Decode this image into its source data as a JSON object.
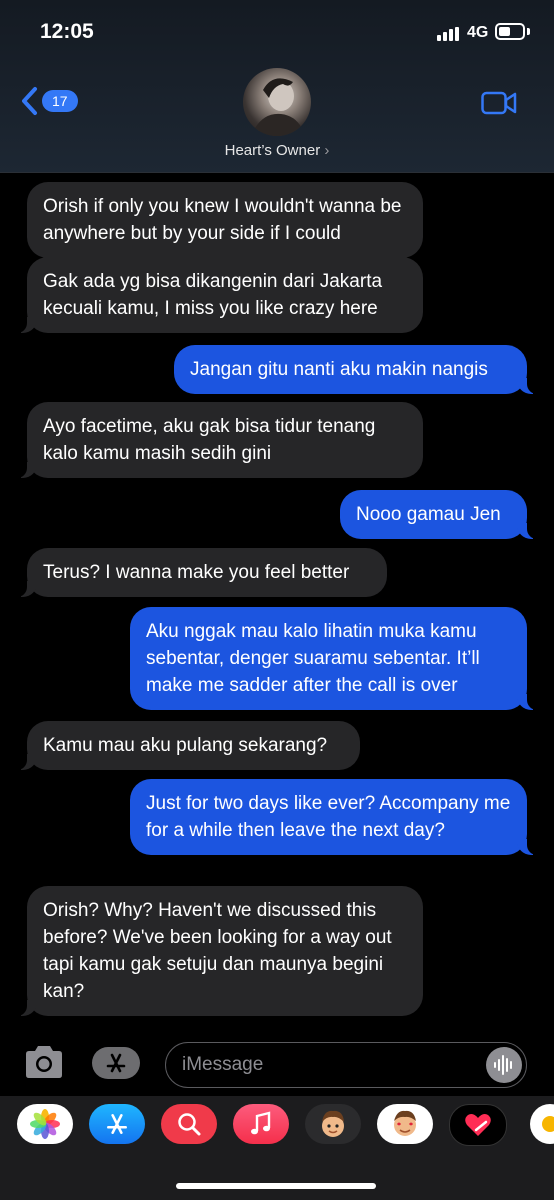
{
  "status": {
    "time": "12:05",
    "network": "4G"
  },
  "header": {
    "back_count": "17",
    "contact_name": "Heart’s Owner",
    "name_chevron": "›"
  },
  "messages": [
    {
      "dir": "in",
      "text": "Orish if only you knew I wouldn't wanna be anywhere but by your side if I could"
    },
    {
      "dir": "in",
      "text": "Gak ada yg bisa dikangenin dari Jakarta kecuali kamu, I miss you like crazy here"
    },
    {
      "dir": "out",
      "text": "Jangan gitu nanti aku makin nangis"
    },
    {
      "dir": "in",
      "text": "Ayo facetime, aku gak bisa tidur tenang kalo kamu masih sedih gini"
    },
    {
      "dir": "out",
      "text": "Nooo gamau Jen"
    },
    {
      "dir": "in",
      "text": "Terus? I wanna make you feel better"
    },
    {
      "dir": "out",
      "text": "Aku nggak mau kalo lihatin muka kamu sebentar, denger suaramu sebentar. It’ll make me sadder after the call is over"
    },
    {
      "dir": "in",
      "text": "Kamu mau aku pulang sekarang?"
    },
    {
      "dir": "out",
      "text": "Just for two days like ever? Accompany me for a while then leave the next day?"
    },
    {
      "dir": "in",
      "text": "Orish? Why? Haven't we discussed this before? We've been looking for a way out tapi kamu gak setuju dan maunya begini kan?"
    }
  ],
  "composer": {
    "placeholder": "iMessage"
  },
  "app_tray": [
    "photos-icon",
    "app-store-icon",
    "search-images-icon",
    "music-icon",
    "memoji-icon",
    "memoji-stickers-icon",
    "digital-touch-icon",
    "more-app-icon"
  ],
  "colors": {
    "incoming_bubble": "#262628",
    "outgoing_bubble": "#1c55e0",
    "accent": "#3478f6"
  }
}
